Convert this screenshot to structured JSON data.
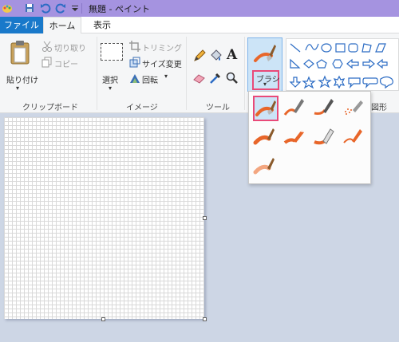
{
  "window": {
    "title": "無題 - ペイント"
  },
  "quick_access": {
    "icons": [
      "paint-app-icon",
      "save-icon",
      "undo-icon",
      "redo-icon",
      "customize-dropdown-icon"
    ]
  },
  "tabs": {
    "file": "ファイル",
    "home": "ホーム",
    "view": "表示"
  },
  "clipboard": {
    "paste": "貼り付け",
    "cut": "切り取り",
    "copy": "コピー",
    "label": "クリップボード"
  },
  "image": {
    "select": "選択",
    "crop": "トリミング",
    "resize": "サイズ変更",
    "rotate": "回転",
    "label": "イメージ"
  },
  "tools": {
    "label": "ツール"
  },
  "brushes": {
    "label": "ブラシ",
    "options": [
      "brush",
      "calligraphy-brush-1",
      "calligraphy-brush-2",
      "airbrush",
      "oil-brush",
      "crayon",
      "marker",
      "natural-pencil",
      "watercolor-brush"
    ],
    "selected_index": 0
  },
  "shapes": {
    "label": "図形"
  },
  "colors": {
    "accent": "#1979ca",
    "highlight": "#e94a79",
    "titlebar": "#a593e0"
  }
}
